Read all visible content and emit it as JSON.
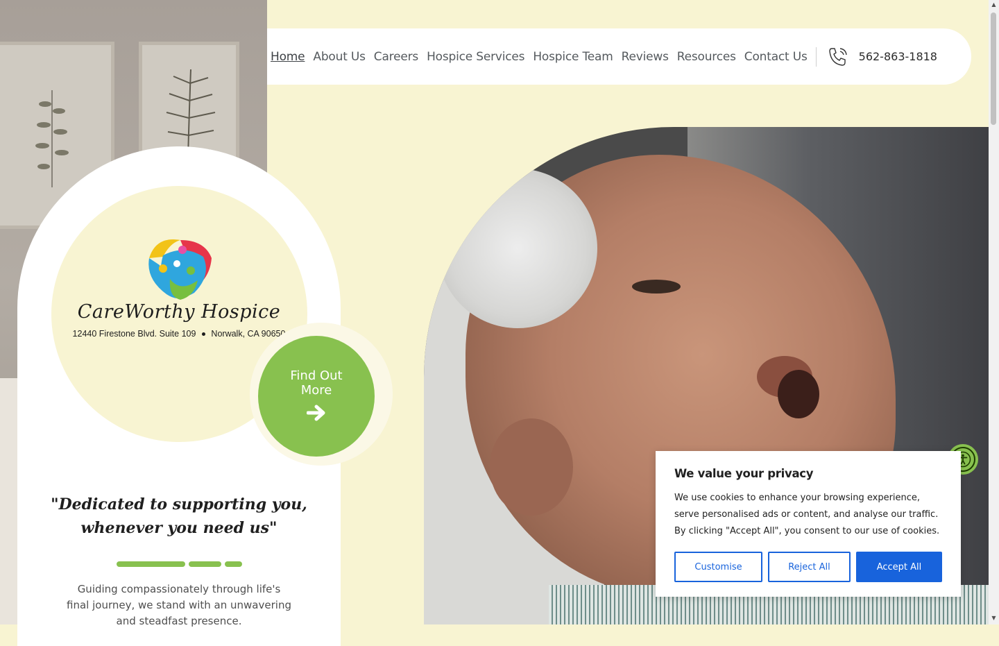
{
  "nav": {
    "links": [
      "Home",
      "About Us",
      "Careers",
      "Hospice Services",
      "Hospice Team",
      "Reviews",
      "Resources",
      "Contact Us"
    ],
    "active": "Home",
    "phone": "562-863-1818"
  },
  "brand": {
    "name": "CareWorthy Hospice",
    "address_street": "12440 Firestone Blvd. Suite 109",
    "address_city": "Norwalk, CA 90650"
  },
  "cta": {
    "label": "Find Out More"
  },
  "hero": {
    "tagline": "\"Dedicated to supporting you, whenever you need us\"",
    "intro": "Guiding compassionately through life's final journey, we stand with an unwavering and steadfast presence."
  },
  "cookie": {
    "title": "We value your privacy",
    "body": "We use cookies to enhance your browsing experience, serve personalised ads or content, and analyse our traffic. By clicking \"Accept All\", you consent to our use of cookies.",
    "customise_label": "Customise",
    "reject_label": "Reject All",
    "accept_label": "Accept All"
  },
  "colors": {
    "cream": "#f8f4d2",
    "accent_green": "#88c14f",
    "cookie_blue": "#1863dc"
  },
  "icons": {
    "phone": "phone-ringing-icon",
    "arrow": "arrow-right-icon",
    "accessibility": "accessibility-icon"
  }
}
